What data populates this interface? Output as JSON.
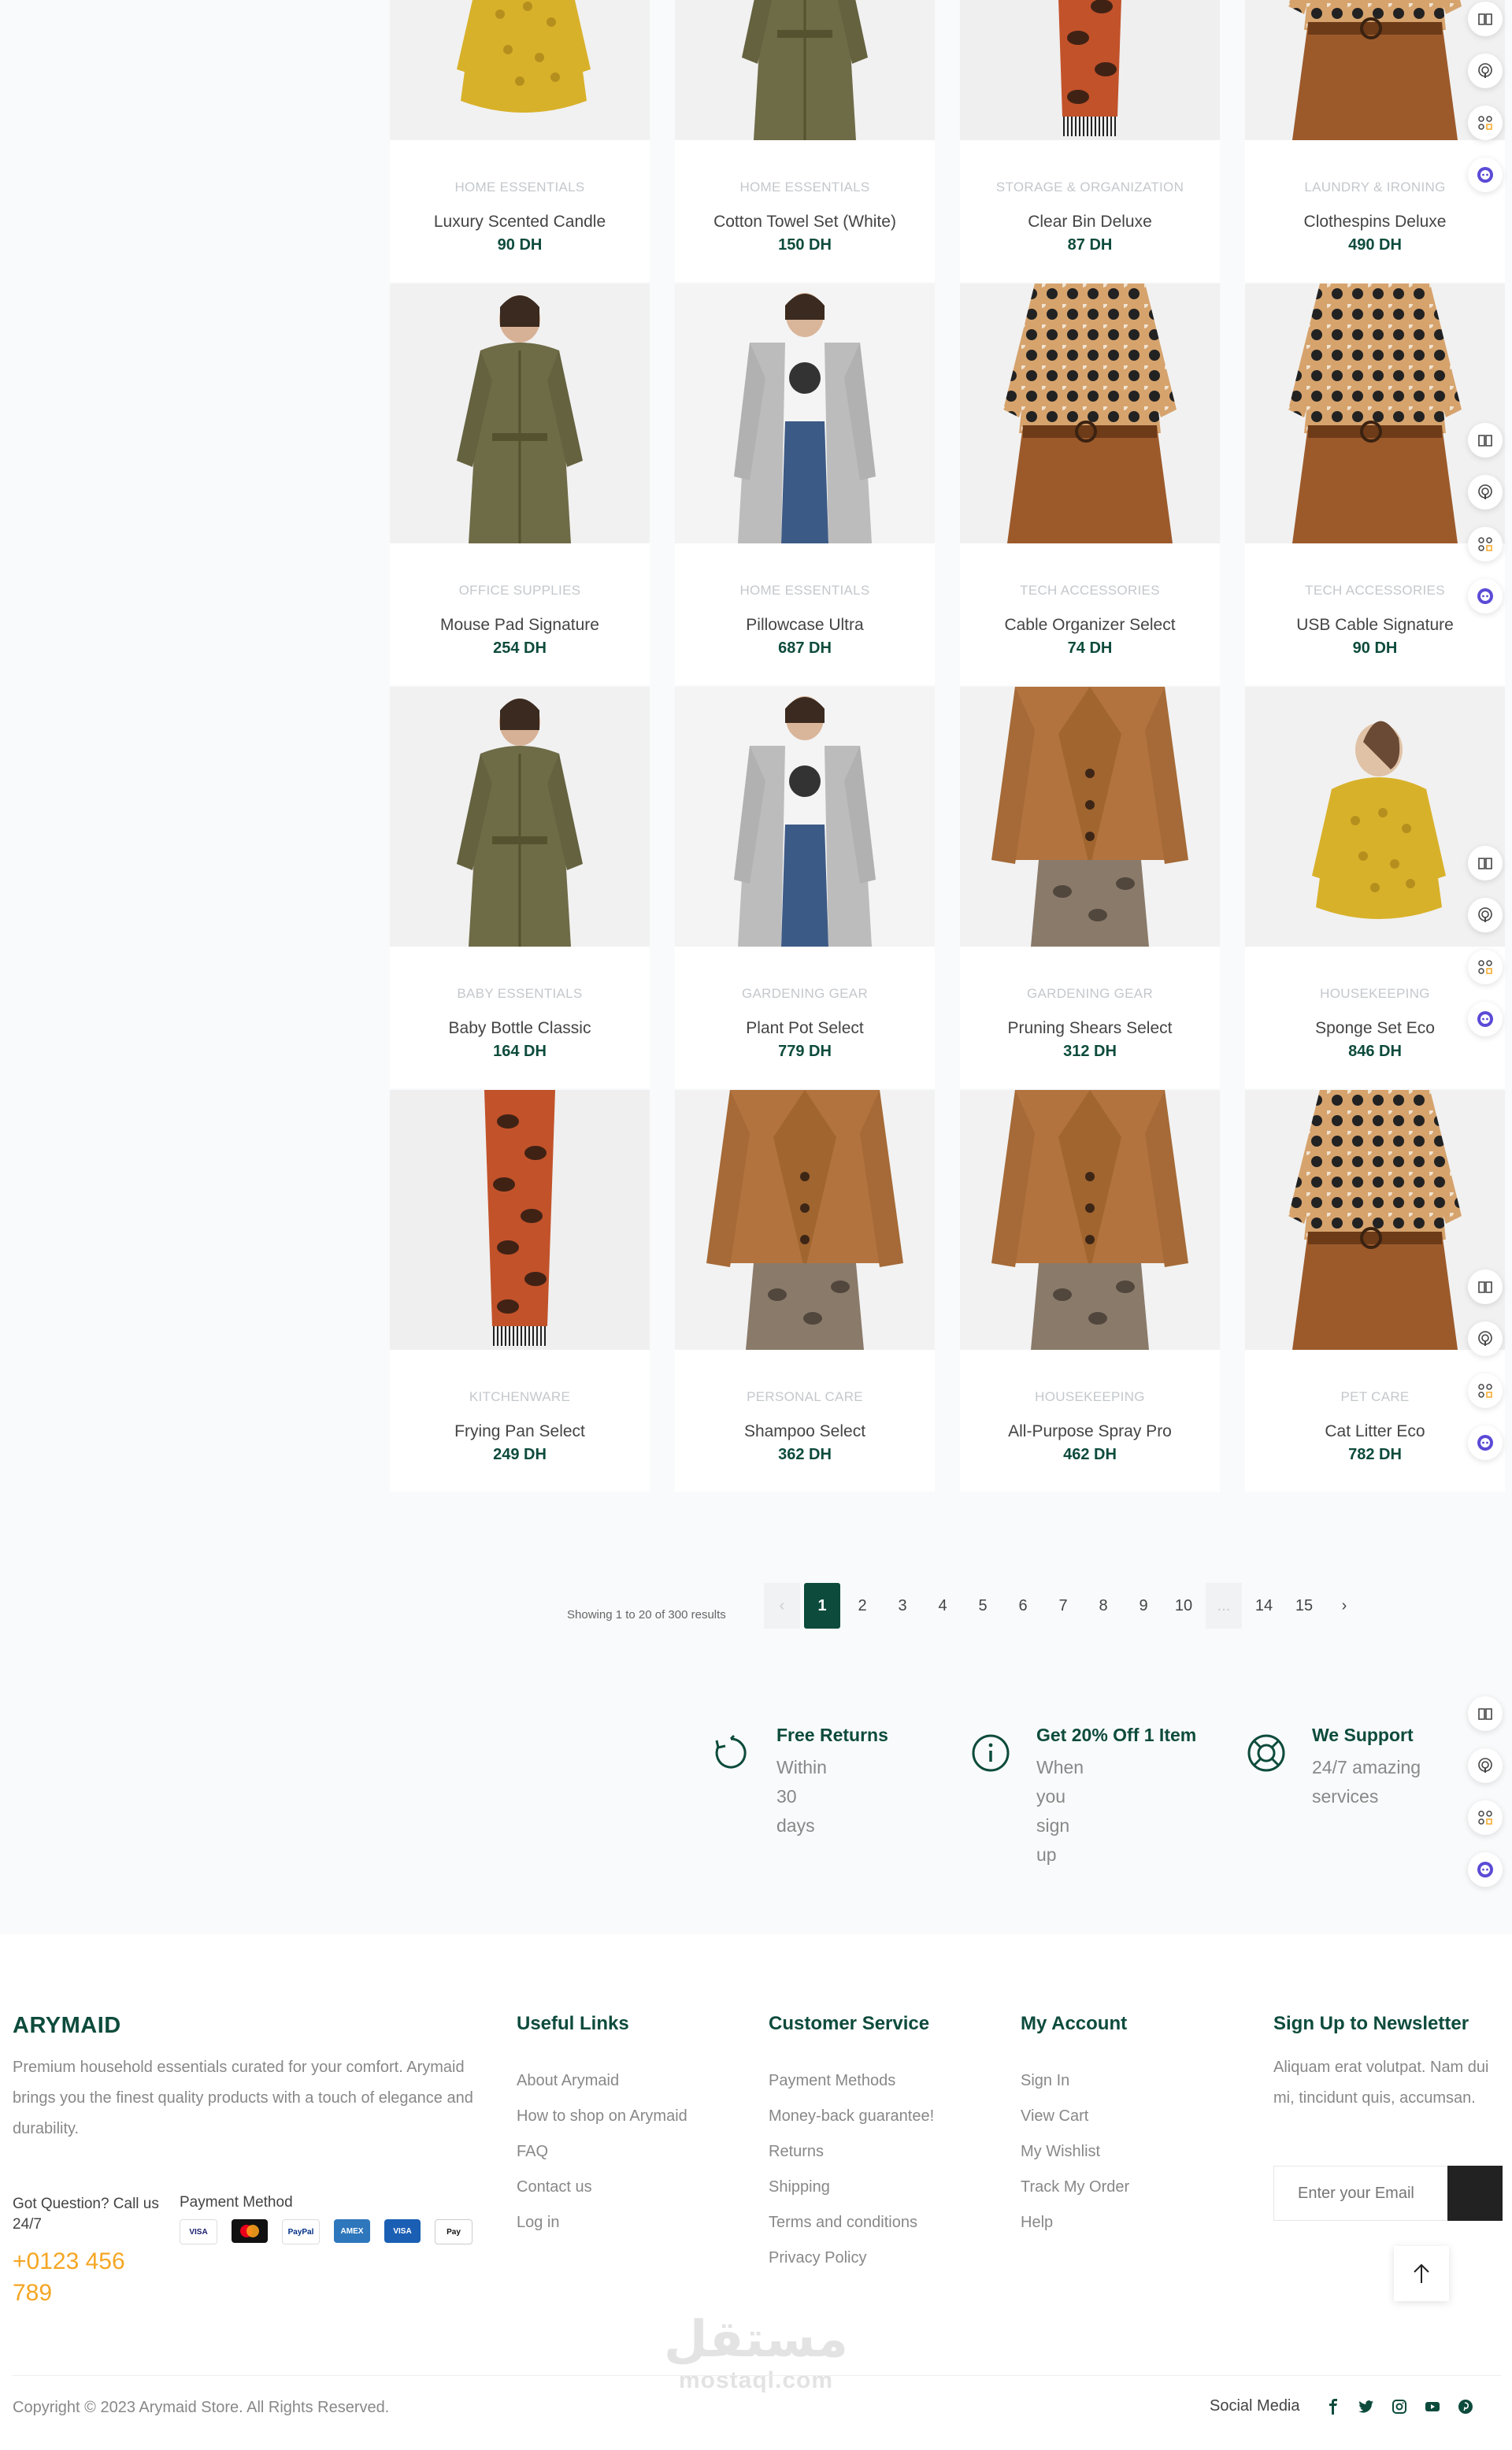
{
  "products": [
    {
      "category": "HOME ESSENTIALS",
      "title": "Luxury Scented Candle",
      "price": "90 DH",
      "image": "yellow-dress"
    },
    {
      "category": "HOME ESSENTIALS",
      "title": "Cotton Towel Set (White)",
      "price": "150 DH",
      "image": "olive-jumpsuit"
    },
    {
      "category": "STORAGE & ORGANIZATION",
      "title": "Clear Bin Deluxe",
      "price": "87 DH",
      "image": "snake-scarf"
    },
    {
      "category": "LAUNDRY & IRONING",
      "title": "Clothespins Deluxe",
      "price": "490 DH",
      "image": "patterned-top"
    },
    {
      "category": "OFFICE SUPPLIES",
      "title": "Mouse Pad Signature",
      "price": "254 DH",
      "image": "olive-jumpsuit"
    },
    {
      "category": "HOME ESSENTIALS",
      "title": "Pillowcase Ultra",
      "price": "687 DH",
      "image": "grey-cardigan"
    },
    {
      "category": "TECH ACCESSORIES",
      "title": "Cable Organizer Select",
      "price": "74 DH",
      "image": "patterned-top"
    },
    {
      "category": "TECH ACCESSORIES",
      "title": "USB Cable Signature",
      "price": "90 DH",
      "image": "patterned-top"
    },
    {
      "category": "BABY ESSENTIALS",
      "title": "Baby Bottle Classic",
      "price": "164 DH",
      "image": "olive-jumpsuit"
    },
    {
      "category": "GARDENING GEAR",
      "title": "Plant Pot Select",
      "price": "779 DH",
      "image": "grey-cardigan"
    },
    {
      "category": "GARDENING GEAR",
      "title": "Pruning Shears Select",
      "price": "312 DH",
      "image": "brown-cardigan"
    },
    {
      "category": "HOUSEKEEPING",
      "title": "Sponge Set Eco",
      "price": "846 DH",
      "image": "yellow-dress"
    },
    {
      "category": "KITCHENWARE",
      "title": "Frying Pan Select",
      "price": "249 DH",
      "image": "snake-scarf"
    },
    {
      "category": "PERSONAL CARE",
      "title": "Shampoo Select",
      "price": "362 DH",
      "image": "brown-cardigan"
    },
    {
      "category": "HOUSEKEEPING",
      "title": "All-Purpose Spray Pro",
      "price": "462 DH",
      "image": "brown-cardigan"
    },
    {
      "category": "PET CARE",
      "title": "Cat Litter Eco",
      "price": "782 DH",
      "image": "patterned-top"
    }
  ],
  "side_rail_icons": [
    "book-icon",
    "podcast-icon",
    "apps-icon",
    "bot-icon"
  ],
  "pagination": {
    "info": "Showing 1 to 20 of 300 results",
    "prev": "‹",
    "pages": [
      "1",
      "2",
      "3",
      "4",
      "5",
      "6",
      "7",
      "8",
      "9",
      "10",
      "...",
      "14",
      "15"
    ],
    "next": "›",
    "current": "1"
  },
  "features": [
    {
      "title": "Free Returns",
      "subtitle": "Within 30 days",
      "icon": "returns-icon"
    },
    {
      "title": "Get 20% Off 1 Item",
      "subtitle": "When you sign up",
      "icon": "info-icon"
    },
    {
      "title": "We Support",
      "subtitle": "24/7 amazing services",
      "icon": "support-icon"
    }
  ],
  "footer": {
    "brand": "ARYMAID",
    "description": "Premium household essentials curated for your comfort. Arymaid brings you the finest quality products with a touch of elegance and durability.",
    "question": "Got Question? Call us 24/7",
    "phone": "+0123 456 789",
    "payment_title": "Payment Method",
    "payment_methods": [
      "VISA",
      "Mastercard",
      "PayPal",
      "Amex",
      "VISA",
      "Apple Pay"
    ],
    "columns": [
      {
        "title": "Useful Links",
        "links": [
          "About Arymaid",
          "How to shop on Arymaid",
          "FAQ",
          "Contact us",
          "Log in"
        ]
      },
      {
        "title": "Customer Service",
        "links": [
          "Payment Methods",
          "Money-back guarantee!",
          "Returns",
          "Shipping",
          "Terms and conditions",
          "Privacy Policy"
        ]
      },
      {
        "title": "My Account",
        "links": [
          "Sign In",
          "View Cart",
          "My Wishlist",
          "Track My Order",
          "Help"
        ]
      }
    ],
    "newsletter": {
      "title": "Sign Up to Newsletter",
      "description": "Aliquam erat volutpat. Nam dui mi, tincidunt quis, accumsan.",
      "placeholder": "Enter your Email"
    },
    "watermark": {
      "arabic": "مستقل",
      "latin": "mostaql.com"
    },
    "copyright": "Copyright © 2023 Arymaid Store. All Rights Reserved.",
    "social_label": "Social Media",
    "social_icons": [
      "facebook-icon",
      "twitter-icon",
      "instagram-icon",
      "youtube-icon",
      "pinterest-icon"
    ]
  },
  "colors": {
    "brand": "#0d4b3c",
    "accent": "#f5a623",
    "muted": "#888888"
  }
}
